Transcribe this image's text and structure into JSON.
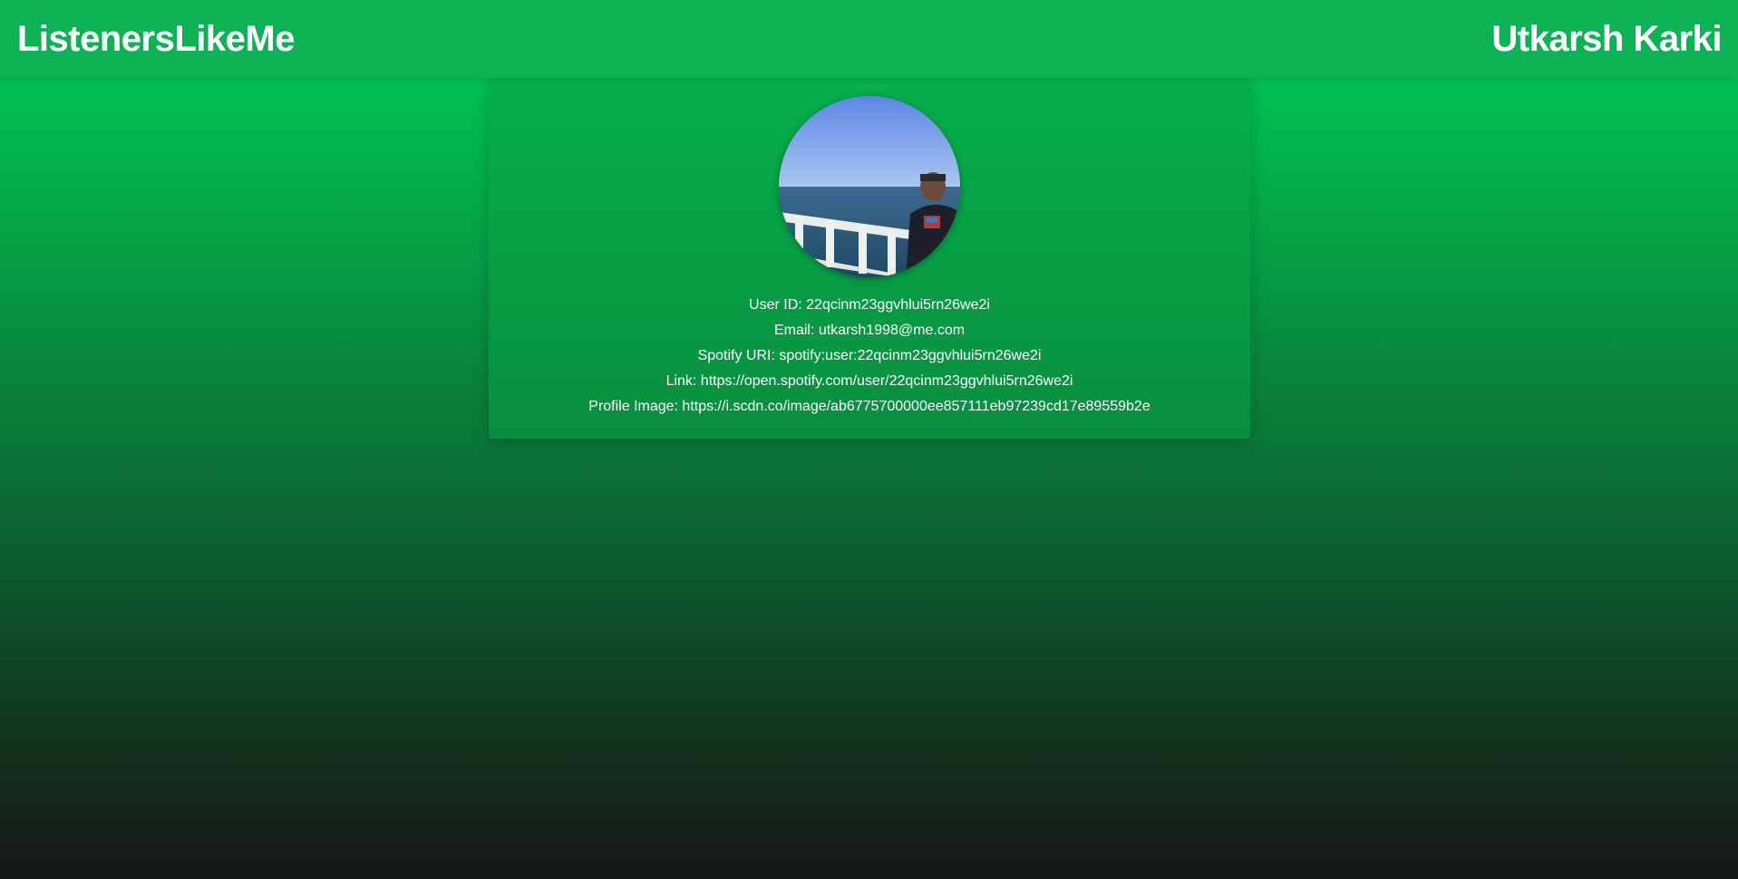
{
  "header": {
    "brand": "ListenersLikeMe",
    "user_name": "Utkarsh Karki"
  },
  "profile": {
    "avatar_icon": "profile-photo",
    "lines": [
      "User ID: 22qcinm23ggvhlui5rn26we2i",
      "Email: utkarsh1998@me.com",
      "Spotify URI: spotify:user:22qcinm23ggvhlui5rn26we2i",
      "Link: https://open.spotify.com/user/22qcinm23ggvhlui5rn26we2i",
      "Profile Image: https://i.scdn.co/image/ab6775700000ee857111eb97239cd17e89559b2e"
    ]
  },
  "colors": {
    "header_bg": "#0db254",
    "gradient_top": "#00d15a",
    "gradient_bottom": "#171717",
    "text": "#ffffff"
  }
}
